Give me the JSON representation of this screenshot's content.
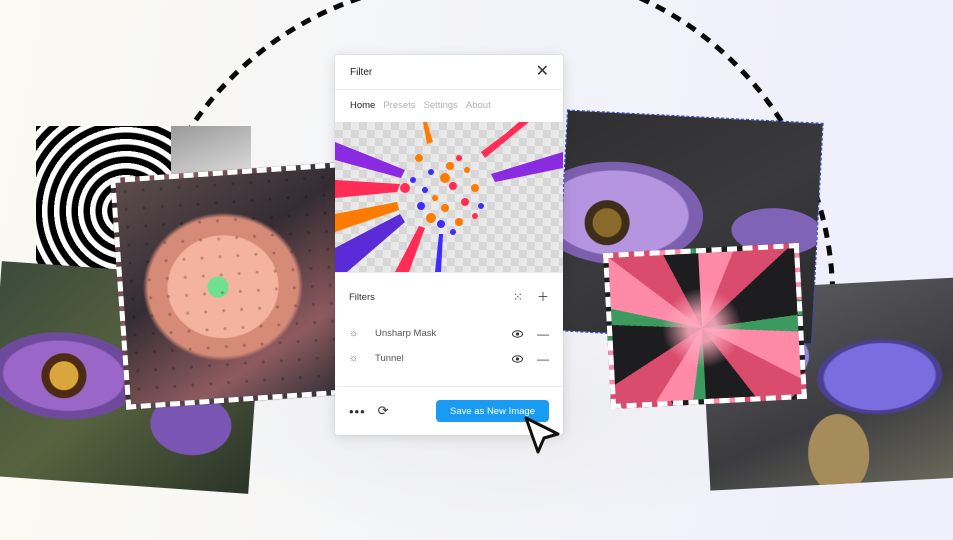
{
  "panel": {
    "title": "Filter",
    "tabs": [
      {
        "label": "Home",
        "active": true
      },
      {
        "label": "Presets",
        "active": false
      },
      {
        "label": "Settings",
        "active": false
      },
      {
        "label": "About",
        "active": false
      }
    ],
    "filters": {
      "title": "Filters",
      "items": [
        {
          "name": "Unsharp Mask"
        },
        {
          "name": "Tunnel"
        }
      ]
    },
    "footer": {
      "save_label": "Save as New Image"
    }
  },
  "colors": {
    "accent": "#199af3",
    "selection_outline": "#2d45d8"
  },
  "icons": {
    "close": "close-icon",
    "add": "plus-icon",
    "drag": "grid-dots-icon",
    "visible": "eye-icon",
    "remove": "minus-icon",
    "filter": "sun-icon",
    "more": "more-dots-icon",
    "refresh": "refresh-icon",
    "cursor": "cursor-arrow-icon"
  }
}
